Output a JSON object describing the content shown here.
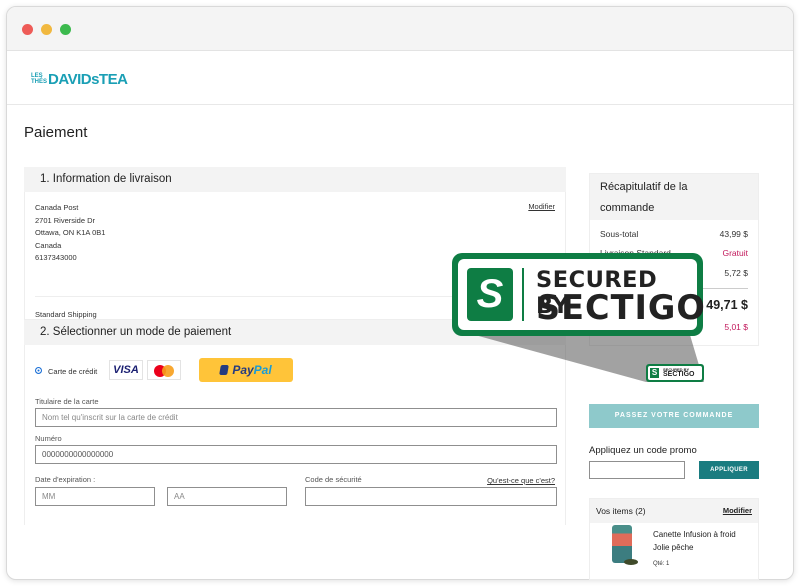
{
  "brand": {
    "logo_small_1": "LES",
    "logo_small_2": "THÉS",
    "logo_main": "DAVIDsTEA",
    "accent": "#1a9fb5"
  },
  "page_title": "Paiement",
  "shipping": {
    "heading": "1. Information de livraison",
    "modify": "Modifier",
    "address_lines": [
      "Canada Post",
      "2701 Riverside Dr",
      "Ottawa, ON K1A 0B1",
      "Canada",
      "6137343000"
    ],
    "method": "Standard Shipping"
  },
  "payment": {
    "heading": "2. Sélectionner un mode de paiement",
    "option_card": "Carte de crédit",
    "visa": "VISA",
    "paypal_a": "Pay",
    "paypal_b": "Pal",
    "holder_label": "Titulaire de la carte",
    "holder_placeholder": "Nom tel qu'inscrit sur la carte de crédit",
    "number_label": "Numéro",
    "number_value": "0000000000000000",
    "expiry_label": "Date d'expiration :",
    "month_placeholder": "MM",
    "year_placeholder": "AA",
    "cvv_label": "Code de sécurité",
    "cvv_help": "Qu'est-ce que c'est?"
  },
  "summary": {
    "heading_1": "Récapitulatif de la",
    "heading_2": "commande",
    "subtotal_label": "Sous-total",
    "subtotal": "43,99 $",
    "shipping_label": "Livraison Standard",
    "shipping_value": "Gratuit",
    "tax_value": "5,72 $",
    "total": "49,71 $",
    "savings": "5,01 $"
  },
  "place_order": "PASSEZ VOTRE COMMANDE",
  "promo": {
    "label": "Appliquez un code promo",
    "apply": "APPLIQUER"
  },
  "items": {
    "heading": "Vos items (2)",
    "modify": "Modifier",
    "name": "Canette Infusion à froid Jolie pêche",
    "qty": "Qté: 1"
  },
  "sectigo": {
    "line1": "SECURED BY",
    "line2": "SECTIGO",
    "letter": "S",
    "color": "#0e7d44"
  }
}
